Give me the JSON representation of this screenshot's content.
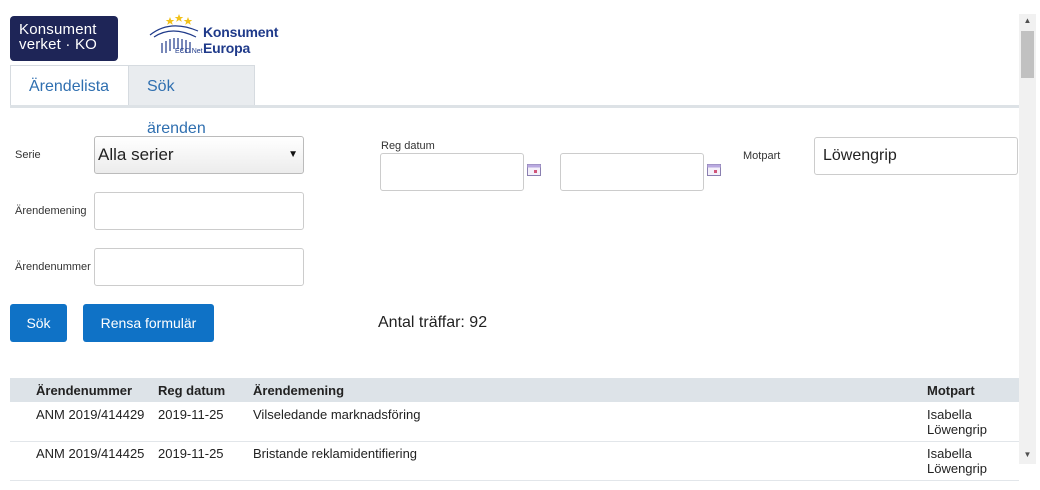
{
  "logos": {
    "ko_line1": "Konsument",
    "ko_line2": "verket · KO",
    "eu_line1": "Konsument",
    "eu_line2": "Europa",
    "eu_small": "ECC Net"
  },
  "tabs": [
    {
      "label": "Ärendelista",
      "active": true
    },
    {
      "label": "Sök ärenden",
      "active": false
    }
  ],
  "form": {
    "serie_label": "Serie",
    "serie_value": "Alla serier",
    "arendemening_label": "Ärendemening",
    "arendemening_value": "",
    "arendenummer_label": "Ärendenummer",
    "arendenummer_value": "",
    "reg_datum_label": "Reg datum",
    "reg_datum_from": "",
    "reg_datum_to": "",
    "motpart_label": "Motpart",
    "motpart_value": "Löwengrip"
  },
  "buttons": {
    "search": "Sök",
    "clear": "Rensa formulär"
  },
  "hits_text": "Antal träffar: 92",
  "table": {
    "headers": [
      "Ärendenummer",
      "Reg datum",
      "Ärendemening",
      "Motpart"
    ],
    "rows": [
      {
        "nummer": "ANM 2019/414429",
        "datum": "2019-11-25",
        "mening": "Vilseledande marknadsföring",
        "motpart": "Isabella Löwengrip"
      },
      {
        "nummer": "ANM 2019/414425",
        "datum": "2019-11-25",
        "mening": "Bristande reklamidentifiering",
        "motpart": "Isabella Löwengrip"
      }
    ]
  },
  "colors": {
    "brand_dark": "#1e2557",
    "button_blue": "#0f72c6",
    "tab_text": "#2f6fb0"
  }
}
